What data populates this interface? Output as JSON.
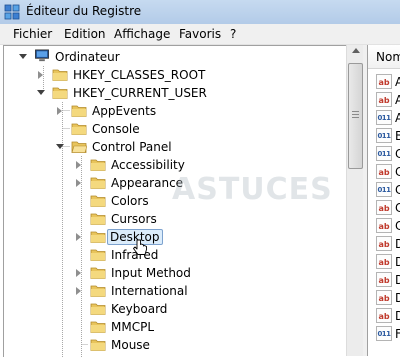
{
  "window": {
    "title": "Éditeur du Registre"
  },
  "menu": [
    "Fichier",
    "Edition",
    "Affichage",
    "Favoris",
    "?"
  ],
  "tree": {
    "root": "Ordinateur",
    "hkey_classes_root": "HKEY_CLASSES_ROOT",
    "hkey_current_user": "HKEY_CURRENT_USER",
    "level2": [
      "AppEvents",
      "Console",
      "Control Panel"
    ],
    "control_panel_children": [
      "Accessibility",
      "Appearance",
      "Colors",
      "Cursors",
      "Desktop",
      "Infrared",
      "Input Method",
      "International",
      "Keyboard",
      "MMCPL",
      "Mouse"
    ],
    "selected": "Desktop"
  },
  "list": {
    "column_header": "Nom",
    "rows": [
      {
        "icon": "ab",
        "text": "A"
      },
      {
        "icon": "ab",
        "text": "A"
      },
      {
        "icon": "bin",
        "text": "A"
      },
      {
        "icon": "bin",
        "text": "B"
      },
      {
        "icon": "bin",
        "text": "C"
      },
      {
        "icon": "ab",
        "text": "C"
      },
      {
        "icon": "bin",
        "text": "C"
      },
      {
        "icon": "ab",
        "text": "C"
      },
      {
        "icon": "ab",
        "text": "C"
      },
      {
        "icon": "ab",
        "text": "D"
      },
      {
        "icon": "ab",
        "text": "D"
      },
      {
        "icon": "ab",
        "text": "D"
      },
      {
        "icon": "ab",
        "text": "D"
      },
      {
        "icon": "ab",
        "text": "D"
      },
      {
        "icon": "bin",
        "text": "F"
      }
    ]
  },
  "watermark": "ASTUCES",
  "colors": {
    "titlebar": "#bcd2ec",
    "selection": "#dbecfb",
    "folder": "#e8c45c"
  }
}
